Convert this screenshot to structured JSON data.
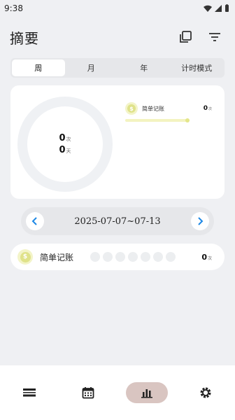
{
  "status": {
    "time": "9:38"
  },
  "header": {
    "title": "摘要",
    "copy_icon": "copy-icon",
    "filter_icon": "filter-icon"
  },
  "tabs": [
    {
      "label": "周",
      "active": true
    },
    {
      "label": "月",
      "active": false
    },
    {
      "label": "年",
      "active": false
    },
    {
      "label": "计时模式",
      "active": false
    }
  ],
  "summary": {
    "count": "0",
    "count_unit": "次",
    "days": "0",
    "days_unit": "天",
    "legend": {
      "label": "简单记账",
      "value": "0",
      "unit": "次"
    },
    "colors": {
      "ring": "#eff1f4",
      "coin": "#dfe28a"
    }
  },
  "date_range": {
    "text": "2025-07-07~07-13",
    "prev_icon": "chevron-left-icon",
    "next_icon": "chevron-right-icon"
  },
  "habit_row": {
    "label": "简单记账",
    "value": "0",
    "unit": "次",
    "day_dots": 7
  },
  "bottom_nav": [
    {
      "icon": "list-icon",
      "active": false
    },
    {
      "icon": "calendar-icon",
      "active": false
    },
    {
      "icon": "chart-icon",
      "active": true
    },
    {
      "icon": "settings-icon",
      "active": false
    }
  ],
  "accent_color": "#1e88e5"
}
